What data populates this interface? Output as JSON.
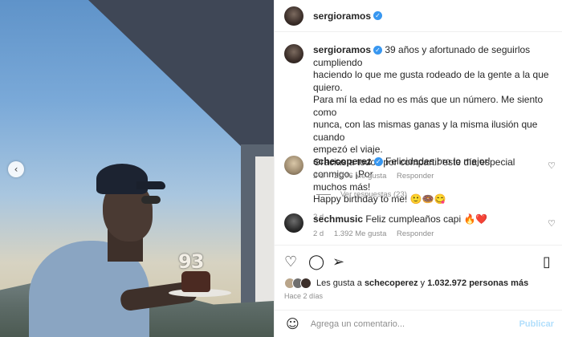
{
  "post": {
    "username": "sergioramos",
    "caption_lines": [
      "39 años y afortunado de seguirlos cumpliendo",
      "haciendo lo que me gusta rodeado de la gente a la que quiero.",
      "Para mí la edad no es más que un número. Me siento como",
      "nunca, con las mismas ganas y la misma ilusión que cuando",
      "empezó el viaje.",
      "Gracias a todos por compartir este día especial conmigo. ¡Por",
      "muchos más!",
      "Happy birthday to me! 🙂🍩😋"
    ],
    "caption_time": "2 d",
    "photo_candles_text": "93"
  },
  "comments": [
    {
      "username": "schecoperez",
      "text": "Felicidades bro lo mejor!",
      "time": "2 d",
      "likes": "2.276 Me gusta",
      "reply_label": "Responder",
      "view_replies": "Ver respuestas (23)"
    },
    {
      "username": "sechmusic",
      "text": "Feliz cumpleaños capi 🔥❤️",
      "time": "2 d",
      "likes": "1.392 Me gusta",
      "reply_label": "Responder"
    }
  ],
  "likes_summary": {
    "prefix": "Les gusta a",
    "user": "schecoperez",
    "connector": "y",
    "count": "1.032.972 personas más"
  },
  "post_time": "Hace 2 días",
  "comment_box": {
    "placeholder": "Agrega un comentario...",
    "publish_label": "Publicar"
  },
  "icons": {
    "verified": "verified-badge-icon",
    "like": "heart-icon",
    "comment": "comment-icon",
    "share": "share-icon",
    "save": "bookmark-icon",
    "emoji": "emoji-icon",
    "prev": "chevron-left-icon"
  },
  "colors": {
    "verified": "#3897f0",
    "muted": "#8e8e8e",
    "publish": "#b2dffc"
  }
}
